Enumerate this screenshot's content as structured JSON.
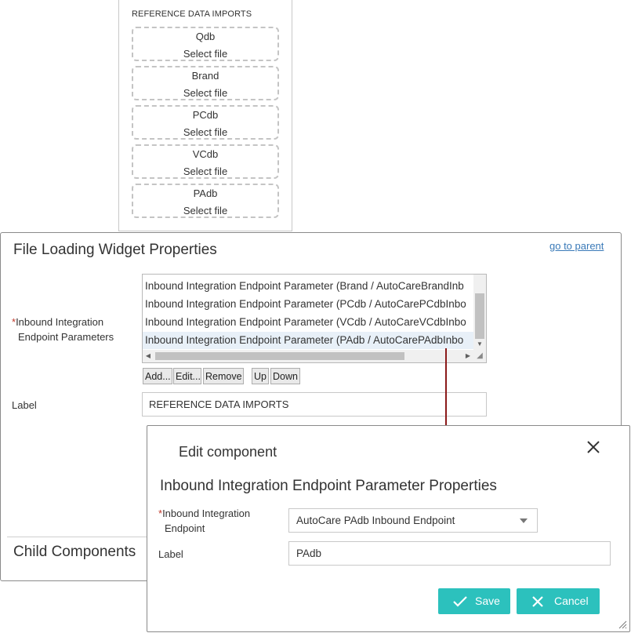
{
  "reference_imports": {
    "title": "REFERENCE DATA IMPORTS",
    "items": [
      {
        "name": "Qdb",
        "action": "Select file"
      },
      {
        "name": "Brand",
        "action": "Select file"
      },
      {
        "name": "PCdb",
        "action": "Select file"
      },
      {
        "name": "VCdb",
        "action": "Select file"
      },
      {
        "name": "PAdb",
        "action": "Select file"
      }
    ]
  },
  "properties": {
    "title": "File Loading Widget Properties",
    "goto_parent": "go to parent",
    "params_required": "*",
    "params_label_line1": "Inbound Integration",
    "params_label_line2": "Endpoint Parameters",
    "params_list": [
      "Inbound Integration Endpoint Parameter (Brand / AutoCareBrandInb",
      "Inbound Integration Endpoint Parameter (PCdb / AutoCarePCdbInbo",
      "Inbound Integration Endpoint Parameter (VCdb / AutoCareVCdbInbo",
      "Inbound Integration Endpoint Parameter (PAdb / AutoCarePAdbInbo"
    ],
    "selected_index": 3,
    "buttons": {
      "add": "Add...",
      "edit": "Edit...",
      "remove": "Remove",
      "up": "Up",
      "down": "Down"
    },
    "label_label": "Label",
    "label_value": "REFERENCE DATA IMPORTS",
    "child_components": "Child Components"
  },
  "dialog": {
    "title": "Edit component",
    "subtitle": "Inbound Integration Endpoint Parameter Properties",
    "endpoint_required": "*",
    "endpoint_label_line1": "Inbound Integration",
    "endpoint_label_line2": "Endpoint",
    "endpoint_value": "AutoCare PAdb Inbound Endpoint",
    "label_label": "Label",
    "label_value": "PAdb",
    "save": "Save",
    "cancel": "Cancel"
  },
  "colors": {
    "accent": "#2cc1bd",
    "connector": "#8b1a1a",
    "link": "#3a7ab8",
    "required": "#c0392b"
  }
}
